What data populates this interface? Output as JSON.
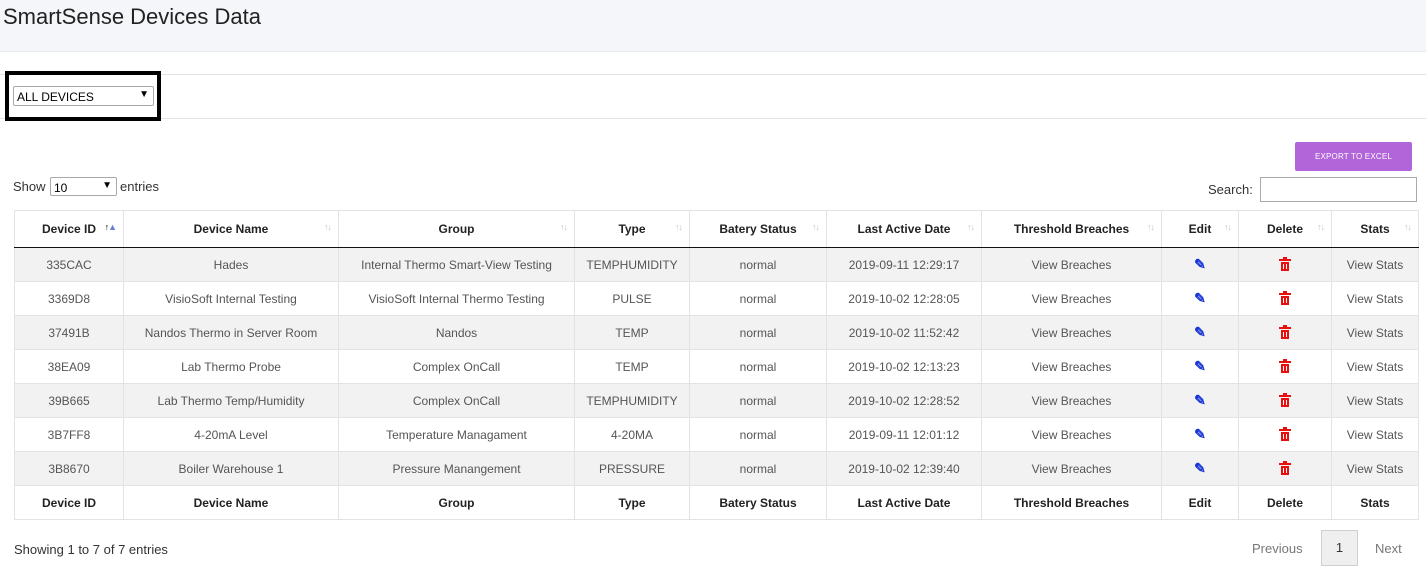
{
  "page": {
    "title": "SmartSense Devices Data"
  },
  "filter": {
    "selected": "ALL DEVICES"
  },
  "toolbar": {
    "export_label": "EXPORT TO EXCEL"
  },
  "length": {
    "show": "Show",
    "value": "10",
    "entries": "entries"
  },
  "search": {
    "label": "Search:",
    "value": ""
  },
  "table": {
    "columns": [
      "Device ID",
      "Device Name",
      "Group",
      "Type",
      "Batery Status",
      "Last Active Date",
      "Threshold Breaches",
      "Edit",
      "Delete",
      "Stats"
    ],
    "sort": {
      "column": "Device ID",
      "direction": "ascending"
    },
    "rows": [
      {
        "id": "335CAC",
        "name": "Hades",
        "group": "Internal Thermo Smart-View Testing",
        "type": "TEMPHUMIDITY",
        "battery": "normal",
        "last_active": "2019-09-11 12:29:17",
        "breaches": "View Breaches",
        "stats": "View Stats"
      },
      {
        "id": "3369D8",
        "name": "VisioSoft Internal Testing",
        "group": "VisioSoft Internal Thermo Testing",
        "type": "PULSE",
        "battery": "normal",
        "last_active": "2019-10-02 12:28:05",
        "breaches": "View Breaches",
        "stats": "View Stats"
      },
      {
        "id": "37491B",
        "name": "Nandos Thermo in Server Room",
        "group": "Nandos",
        "type": "TEMP",
        "battery": "normal",
        "last_active": "2019-10-02 11:52:42",
        "breaches": "View Breaches",
        "stats": "View Stats"
      },
      {
        "id": "38EA09",
        "name": "Lab Thermo Probe",
        "group": "Complex OnCall",
        "type": "TEMP",
        "battery": "normal",
        "last_active": "2019-10-02 12:13:23",
        "breaches": "View Breaches",
        "stats": "View Stats"
      },
      {
        "id": "39B665",
        "name": "Lab Thermo Temp/Humidity",
        "group": "Complex OnCall",
        "type": "TEMPHUMIDITY",
        "battery": "normal",
        "last_active": "2019-10-02 12:28:52",
        "breaches": "View Breaches",
        "stats": "View Stats"
      },
      {
        "id": "3B7FF8",
        "name": "4-20mA Level",
        "group": "Temperature Managament",
        "type": "4-20MA",
        "battery": "normal",
        "last_active": "2019-09-11 12:01:12",
        "breaches": "View Breaches",
        "stats": "View Stats"
      },
      {
        "id": "3B8670",
        "name": "Boiler Warehouse 1",
        "group": "Pressure Manangement",
        "type": "PRESSURE",
        "battery": "normal",
        "last_active": "2019-10-02 12:39:40",
        "breaches": "View Breaches",
        "stats": "View Stats"
      }
    ]
  },
  "footer": {
    "info": "Showing 1 to 7 of 7 entries",
    "pagination": {
      "previous": "Previous",
      "current_page": "1",
      "next": "Next"
    }
  },
  "icons": {
    "edit": "edit-icon",
    "delete": "trash-icon",
    "sort": "sort-arrows-icon",
    "dropdown": "chevron-down-icon"
  },
  "colors": {
    "export_button": "#b264d9",
    "link": "#1a1adb",
    "edit_icon": "#1734d6",
    "delete_icon": "#e8100f",
    "row_stripe": "#f2f2f2"
  }
}
